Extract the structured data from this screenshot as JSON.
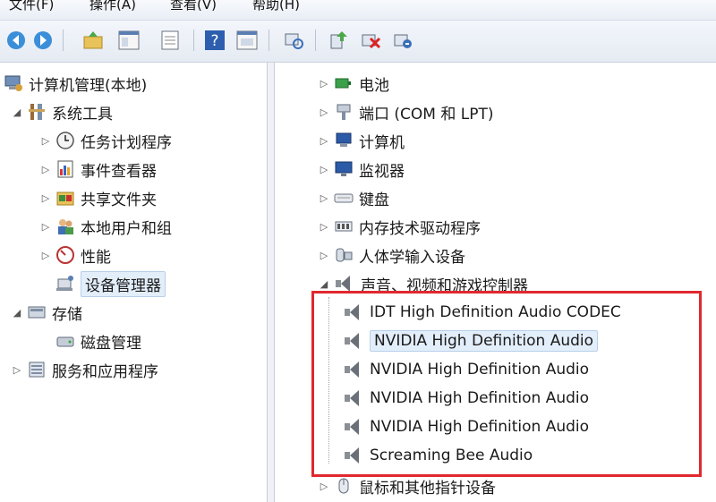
{
  "menubar": {
    "items": [
      "文件(F)",
      "操作(A)",
      "查看(V)",
      "帮助(H)"
    ]
  },
  "toolbar": {
    "buttons": [
      "back-icon",
      "forward-icon",
      "up-folder-icon",
      "show-hide-tree-icon",
      "properties-icon",
      "help-icon",
      "console-icon",
      "scan-hardware-icon",
      "update-driver-icon",
      "disable-device-icon",
      "uninstall-device-icon"
    ]
  },
  "tree": {
    "root": "计算机管理(本地)",
    "system_tools": "系统工具",
    "task_scheduler": "任务计划程序",
    "event_viewer": "事件查看器",
    "shared_folders": "共享文件夹",
    "local_users": "本地用户和组",
    "performance": "性能",
    "device_manager": "设备管理器",
    "storage": "存储",
    "disk_management": "磁盘管理",
    "services": "服务和应用程序"
  },
  "devices": {
    "battery": "电池",
    "ports": "端口 (COM 和 LPT)",
    "computer": "计算机",
    "monitors": "监视器",
    "keyboards": "键盘",
    "memory_tech": "内存技术驱动程序",
    "hid": "人体学输入设备",
    "sound": "声音、视频和游戏控制器",
    "audio_items": [
      "IDT High Definition Audio CODEC",
      "NVIDIA High Definition Audio",
      "NVIDIA High Definition Audio",
      "NVIDIA High Definition Audio",
      "NVIDIA High Definition Audio",
      "Screaming Bee Audio"
    ],
    "mice": "鼠标和其他指针设备"
  },
  "colors": {
    "highlight_box": "#e0282e",
    "selection_bg": "#e3eefb"
  }
}
